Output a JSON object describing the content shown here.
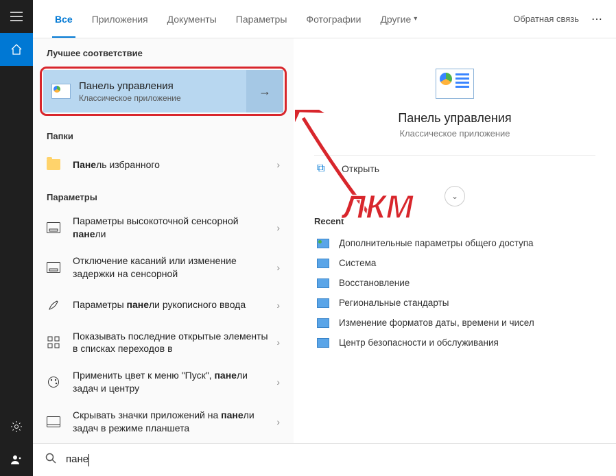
{
  "sidebar": {
    "icons": [
      "menu",
      "home",
      "settings",
      "people"
    ]
  },
  "tabs": {
    "items": [
      {
        "label": "Все",
        "active": true
      },
      {
        "label": "Приложения",
        "active": false
      },
      {
        "label": "Документы",
        "active": false
      },
      {
        "label": "Параметры",
        "active": false
      },
      {
        "label": "Фотографии",
        "active": false
      },
      {
        "label": "Другие",
        "active": false,
        "dropdown": true
      }
    ],
    "feedback": "Обратная связь"
  },
  "results": {
    "best_match_header": "Лучшее соответствие",
    "best_match": {
      "title": "Панель управления",
      "subtitle": "Классическое приложение"
    },
    "folders_header": "Папки",
    "folders": [
      {
        "prefix": "Пане",
        "rest": "ль избранного"
      }
    ],
    "settings_header": "Параметры",
    "settings": [
      {
        "text_html": "Параметры высокоточной сенсорной <b>пане</b>ли"
      },
      {
        "text_html": "Отключение касаний или изменение задержки на сенсорной"
      },
      {
        "text_html": "Параметры <b>пане</b>ли рукописного ввода"
      },
      {
        "text_html": "Показывать последние открытые элементы в списках переходов в"
      },
      {
        "text_html": "Применить цвет к меню \"Пуск\", <b>пане</b>ли задач и центру"
      },
      {
        "text_html": "Скрывать значки приложений на <b>пане</b>ли задач в режиме планшета"
      }
    ]
  },
  "preview": {
    "title": "Панель управления",
    "subtitle": "Классическое приложение",
    "open_action": "Открыть",
    "recent_header": "Recent",
    "recent": [
      "Дополнительные параметры общего доступа",
      "Система",
      "Восстановление",
      "Региональные стандарты",
      "Изменение форматов даты, времени и чисел",
      "Центр безопасности и обслуживания"
    ]
  },
  "search": {
    "value": "пане"
  },
  "annotation": {
    "label": "ЛКМ"
  }
}
